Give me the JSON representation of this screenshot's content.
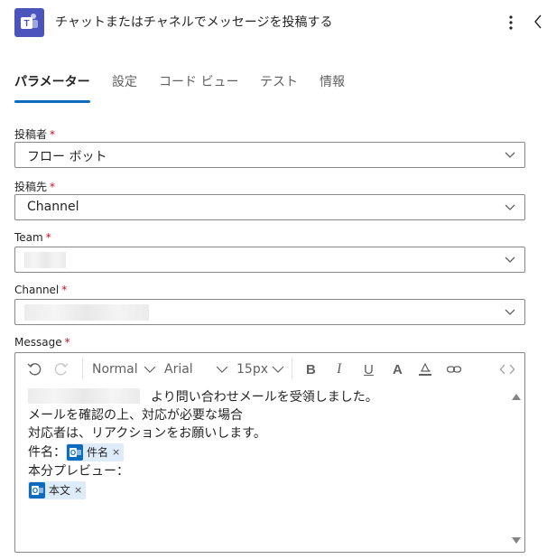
{
  "header": {
    "title": "チャットまたはチャネルでメッセージを投稿する",
    "app_icon": "teams-icon",
    "more_icon": "more-vertical-icon",
    "collapse_icon": "chevron-left-icon"
  },
  "tabs": [
    {
      "label": "パラメーター",
      "active": true
    },
    {
      "label": "設定",
      "active": false
    },
    {
      "label": "コード ビュー",
      "active": false
    },
    {
      "label": "テスト",
      "active": false
    },
    {
      "label": "情報",
      "active": false
    }
  ],
  "fields": {
    "poster": {
      "label": "投稿者",
      "required": "*",
      "value": "フロー ボット"
    },
    "post_in": {
      "label": "投稿先",
      "required": "*",
      "value": "Channel"
    },
    "team": {
      "label": "Team",
      "required": "*",
      "value": ""
    },
    "channel": {
      "label": "Channel",
      "required": "*",
      "value": ""
    },
    "message": {
      "label": "Message",
      "required": "*"
    }
  },
  "toolbar": {
    "style": "Normal",
    "font": "Arial",
    "size": "15px",
    "bold": "B",
    "italic": "I",
    "underline": "U",
    "font_color": "A"
  },
  "message_body": {
    "line1": "より問い合わせメールを受領しました。",
    "line2": "メールを確認の上、対応が必要な場合",
    "line3": "対応者は、リアクションをお願いします。",
    "line4_prefix": "件名：",
    "subject_token": "件名",
    "line5": "本分プレビュー：",
    "body_token": "本文",
    "token_remove": "×"
  },
  "colors": {
    "accent": "#0f6cbd",
    "teams": "#4b53bc",
    "required": "#c50f1f",
    "token_bg": "#deecf9"
  }
}
